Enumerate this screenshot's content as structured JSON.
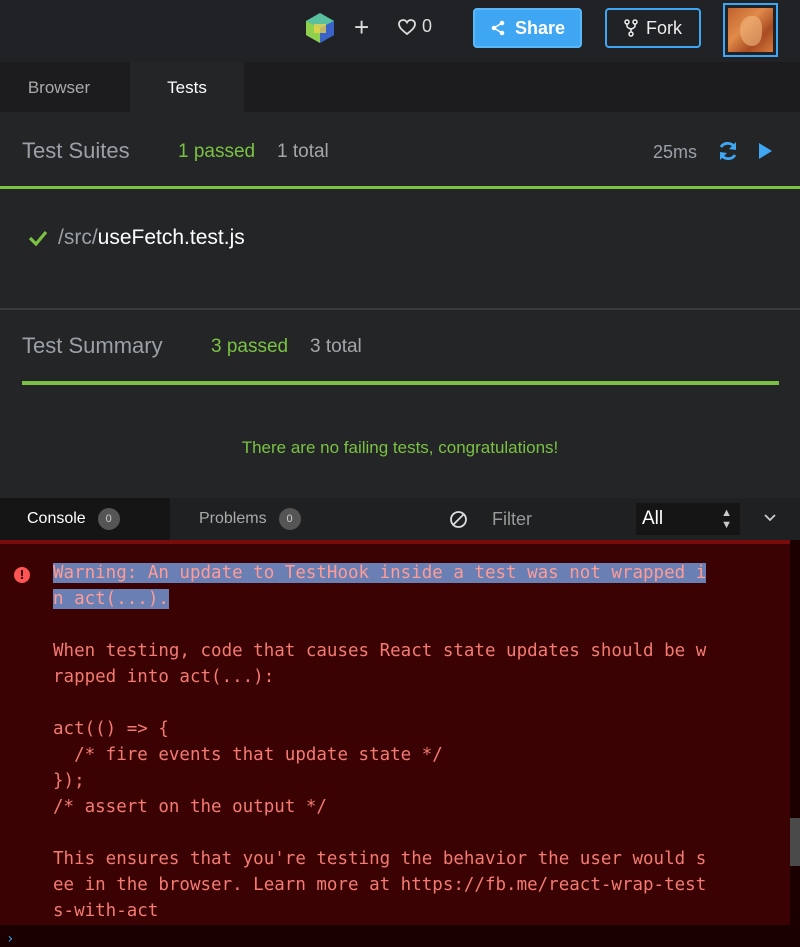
{
  "header": {
    "like_count": "0",
    "share_label": "Share",
    "fork_label": "Fork"
  },
  "preview_tabs": [
    {
      "label": "Browser",
      "active": false
    },
    {
      "label": "Tests",
      "active": true
    }
  ],
  "test_suites": {
    "title": "Test Suites",
    "passed": "1 passed",
    "total": "1 total",
    "duration": "25ms",
    "files": [
      {
        "dir": "/src/",
        "name": "useFetch.test.js",
        "status": "pass"
      }
    ]
  },
  "test_summary": {
    "title": "Test Summary",
    "passed": "3 passed",
    "total": "3 total",
    "message": "There are no failing tests, congratulations!"
  },
  "console": {
    "tabs": [
      {
        "label": "Console",
        "count": "0",
        "active": true
      },
      {
        "label": "Problems",
        "count": "0",
        "active": false
      }
    ],
    "filter_placeholder": "Filter",
    "level": "All",
    "messages": [
      {
        "type": "error",
        "highlighted": "Warning: An update to TestHook inside a test was not wrapped i\nn act(...).",
        "text": "\n\nWhen testing, code that causes React state updates should be w\nrapped into act(...):\n\nact(() => {\n  /* fire events that update state */\n});\n/* assert on the output */\n\nThis ensures that you're testing the behavior the user would s\nee in the browser. Learn more at https://fb.me/react-wrap-test\ns-with-act"
      }
    ],
    "prompt": "›"
  },
  "colors": {
    "accent": "#3ea6f2",
    "pass": "#7bc143",
    "error_bg": "#3a0202",
    "error_text": "#f47a74"
  }
}
